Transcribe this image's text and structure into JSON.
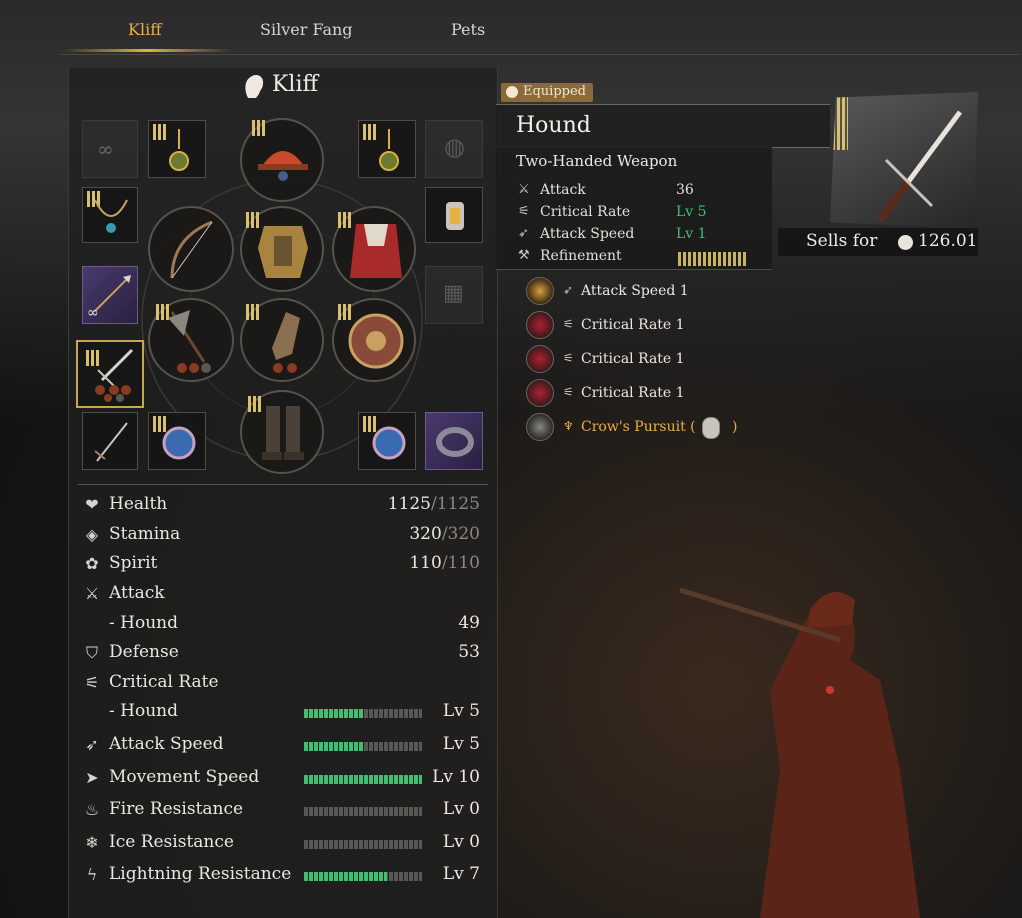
{
  "tabs": [
    {
      "label": "Kliff",
      "active": true
    },
    {
      "label": "Silver Fang",
      "active": false
    },
    {
      "label": "Pets",
      "active": false
    }
  ],
  "character": {
    "name": "Kliff"
  },
  "equipment_slots": [
    {
      "icon": "glasses-icon",
      "state": "empty"
    },
    {
      "icon": "earring-icon",
      "state": "filled"
    },
    {
      "icon": "helmet-icon",
      "state": "filled"
    },
    {
      "icon": "earring-icon",
      "state": "filled"
    },
    {
      "icon": "mask-icon",
      "state": "empty"
    },
    {
      "icon": "necklace-icon",
      "state": "filled"
    },
    {
      "icon": "bow-icon",
      "state": "filled"
    },
    {
      "icon": "chest-armor-icon",
      "state": "filled"
    },
    {
      "icon": "cloak-icon",
      "state": "filled"
    },
    {
      "icon": "lantern-icon",
      "state": "filled"
    },
    {
      "icon": "spear-icon",
      "state": "filled"
    },
    {
      "icon": "backpack-icon",
      "state": "empty"
    },
    {
      "icon": "axe-icon",
      "state": "filled"
    },
    {
      "icon": "gloves-icon",
      "state": "filled"
    },
    {
      "icon": "shield-icon",
      "state": "filled"
    },
    {
      "icon": "sword-icon",
      "state": "selected"
    },
    {
      "icon": "sword-icon",
      "state": "filled"
    },
    {
      "icon": "ring-icon",
      "state": "filled"
    },
    {
      "icon": "boots-icon",
      "state": "filled"
    },
    {
      "icon": "ring-icon",
      "state": "filled"
    },
    {
      "icon": "bracelet-icon",
      "state": "filled"
    }
  ],
  "stats": {
    "health": {
      "label": "Health",
      "value": "1125",
      "max": "/1125",
      "icon": "heart-plus-icon"
    },
    "stamina": {
      "label": "Stamina",
      "value": "320",
      "max": "/320",
      "icon": "stamina-icon"
    },
    "spirit": {
      "label": "Spirit",
      "value": "110",
      "max": "/110",
      "icon": "leaf-icon"
    },
    "attack": {
      "label": "Attack",
      "icon": "sword-icon"
    },
    "attack_hound": {
      "label": "- Hound",
      "value": "49"
    },
    "defense": {
      "label": "Defense",
      "value": "53",
      "icon": "shield-icon"
    },
    "crit": {
      "label": "Critical Rate",
      "icon": "claw-icon"
    },
    "crit_hound": {
      "label": "- Hound",
      "value": "Lv 5",
      "level": 5,
      "max_level": 10
    },
    "attack_speed": {
      "label": "Attack Speed",
      "value": "Lv 5",
      "level": 5,
      "max_level": 10,
      "icon": "speed-icon"
    },
    "movement_speed": {
      "label": "Movement Speed",
      "value": "Lv 10",
      "level": 10,
      "max_level": 10,
      "icon": "boot-icon"
    },
    "fire_res": {
      "label": "Fire Resistance",
      "value": "Lv 0",
      "level": 0,
      "max_level": 10,
      "icon": "flame-icon"
    },
    "ice_res": {
      "label": "Ice Resistance",
      "value": "Lv 0",
      "level": 0,
      "max_level": 10,
      "icon": "snowflake-icon"
    },
    "lightning_res": {
      "label": "Lightning Resistance",
      "value": "Lv 7",
      "level": 7,
      "max_level": 10,
      "icon": "lightning-icon"
    }
  },
  "tooltip": {
    "badge": "Equipped",
    "name": "Hound",
    "type": "Two-Handed Weapon",
    "rows": [
      {
        "label": "Attack",
        "value": "36",
        "icon": "sword-icon"
      },
      {
        "label": "Critical Rate",
        "value": "Lv 5",
        "icon": "claw-icon"
      },
      {
        "label": "Attack Speed",
        "value": "Lv 1",
        "icon": "speed-icon"
      },
      {
        "label": "Refinement",
        "icon": "anvil-icon",
        "level": 10,
        "max_level": 10
      }
    ],
    "sells_label": "Sells for",
    "sells_price": "126.01",
    "sub_effects": [
      {
        "label": "Attack Speed 1",
        "orb": "gold",
        "icon": "speed-icon"
      },
      {
        "label": "Critical Rate 1",
        "orb": "red",
        "icon": "claw-icon"
      },
      {
        "label": "Critical Rate 1",
        "orb": "red",
        "icon": "claw-icon"
      },
      {
        "label": "Critical Rate 1",
        "orb": "red",
        "icon": "claw-icon"
      },
      {
        "label": "Crow's Pursuit (",
        "suffix": ")",
        "orb": "grey",
        "icon": "crow-icon"
      }
    ]
  },
  "colors": {
    "accent": "#e2b04a",
    "bar_fill": "#3cc074",
    "badge": "#8a6a38"
  }
}
